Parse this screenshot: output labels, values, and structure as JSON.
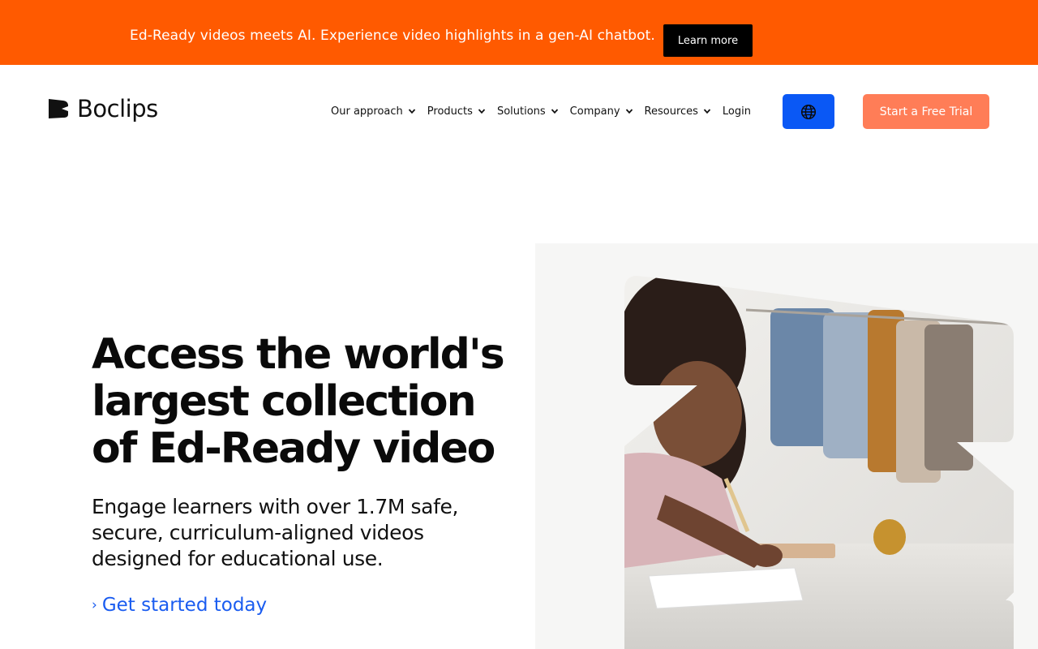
{
  "announcement": {
    "text": "Ed-Ready videos meets AI. Experience video highlights in a gen-AI chatbot.",
    "cta": "Learn more",
    "background": "#ff5a00"
  },
  "header": {
    "logo_text": "Boclips",
    "nav": [
      {
        "label": "Our approach",
        "has_dropdown": true
      },
      {
        "label": "Products",
        "has_dropdown": true
      },
      {
        "label": "Solutions",
        "has_dropdown": true
      },
      {
        "label": "Company",
        "has_dropdown": true
      },
      {
        "label": "Resources",
        "has_dropdown": true
      },
      {
        "label": "Login",
        "has_dropdown": false
      }
    ],
    "language_icon": "globe-icon",
    "trial_button": "Start a Free Trial",
    "colors": {
      "language_button": "#0a58f5",
      "trial_button": "#ff7d57"
    }
  },
  "hero": {
    "title_lines": [
      "Access the world's",
      "largest collection",
      "of Ed-Ready video"
    ],
    "subtitle_lines": [
      "Engage learners with over 1.7M safe,",
      "secure, curriculum-aligned videos",
      "designed for educational use."
    ],
    "cta": "Get started today",
    "cta_color": "#1a5cf0"
  }
}
